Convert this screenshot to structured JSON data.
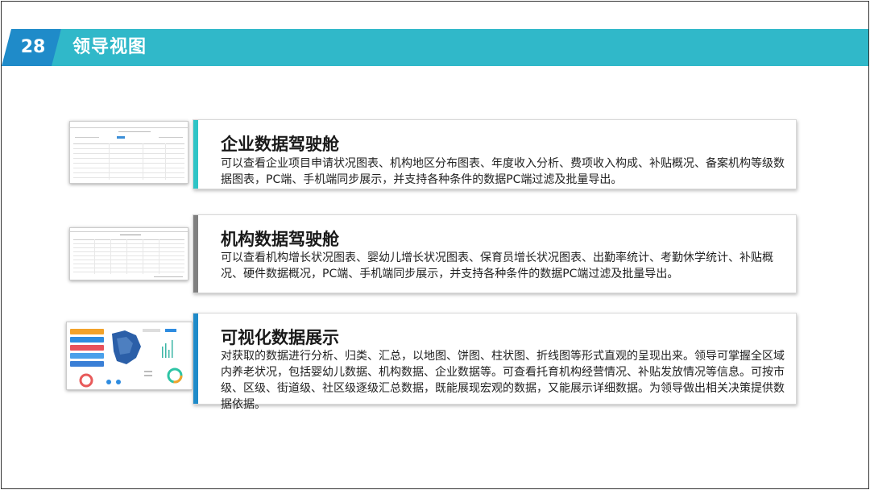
{
  "header": {
    "page_number": "28",
    "title": "领导视图"
  },
  "colors": {
    "header_bar": "#30b8c9",
    "number_badge": "#1f8bc9",
    "accent_teal": "#2ec4c6",
    "accent_gray": "#808080",
    "accent_blue": "#1f8bc9"
  },
  "sections": [
    {
      "title": "企业数据驾驶舱",
      "description": "可以查看企业项目申请状况图表、机构地区分布图表、年度收入分析、费项收入构成、补贴概况、备案机构等级数据图表，PC端、手机端同步展示，并支持各种条件的数据PC端过滤及批量导出。"
    },
    {
      "title": "机构数据驾驶舱",
      "description": "可以查看机构增长状况图表、婴幼儿增长状况图表、保育员增长状况图表、出勤率统计、考勤休学统计、补贴概况、硬件数据概况，PC端、手机端同步展示，并支持各种条件的数据PC端过滤及批量导出。"
    },
    {
      "title": "可视化数据展示",
      "description": "对获取的数据进行分析、归类、汇总，以地图、饼图、柱状图、折线图等形式直观的呈现出来。领导可掌握全区域内养老状况，包括婴幼儿数据、机构数据、企业数据等。可查看托育机构经营情况、补贴发放情况等信息。可按市级、区级、街道级、社区级逐级汇总数据，既能展现宏观的数据，又能展示详细数据。为领导做出相关决策提供数据依据。"
    }
  ]
}
